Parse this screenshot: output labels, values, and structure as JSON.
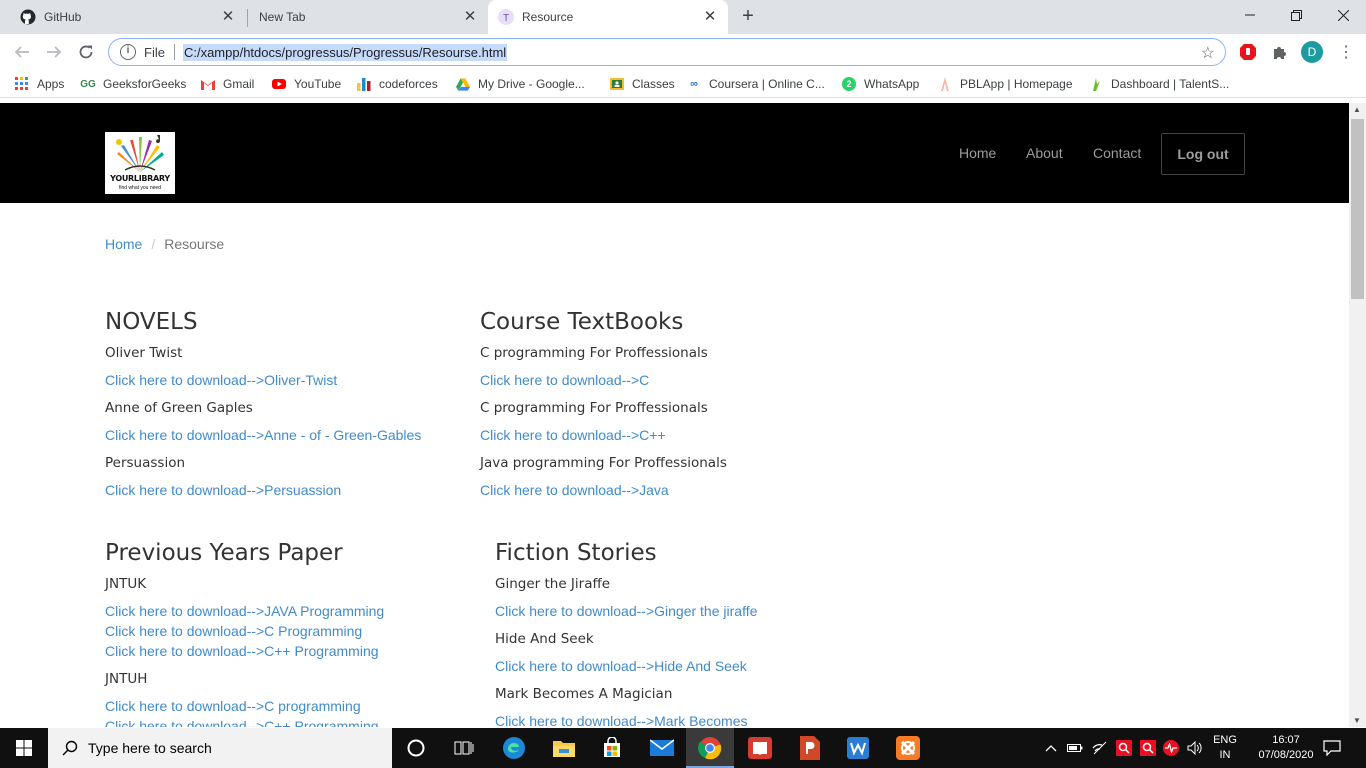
{
  "browser": {
    "tabs": [
      {
        "title": "GitHub",
        "icon": "github-icon"
      },
      {
        "title": "New Tab",
        "icon": ""
      },
      {
        "title": "Resource",
        "icon": "t-favicon-icon",
        "active": true
      }
    ],
    "address": {
      "security_label": "File",
      "url": "C:/xampp/htdocs/progressus/Progressus/Resourse.html"
    },
    "profile_initial": "D",
    "bookmarks": [
      {
        "label": "Apps",
        "icon": "apps-grid-icon"
      },
      {
        "label": "GeeksforGeeks",
        "icon": "gfg-icon"
      },
      {
        "label": "Gmail",
        "icon": "gmail-icon"
      },
      {
        "label": "YouTube",
        "icon": "youtube-icon"
      },
      {
        "label": "codeforces",
        "icon": "codeforces-icon"
      },
      {
        "label": "My Drive - Google...",
        "icon": "drive-icon"
      },
      {
        "label": "Classes",
        "icon": "classroom-icon"
      },
      {
        "label": "Coursera | Online C...",
        "icon": "coursera-icon"
      },
      {
        "label": "WhatsApp",
        "icon": "whatsapp-icon",
        "badge": "2"
      },
      {
        "label": "PBLApp | Homepage",
        "icon": "pblapp-icon"
      },
      {
        "label": "Dashboard | TalentS...",
        "icon": "talent-icon"
      }
    ]
  },
  "site": {
    "logo": {
      "word": "YOURLIBRARY",
      "tagline": "find what you need"
    },
    "nav": {
      "home": "Home",
      "about": "About",
      "contact": "Contact",
      "logout": "Log out"
    },
    "breadcrumb": {
      "home": "Home",
      "current": "Resourse"
    },
    "sections": {
      "novels": {
        "heading": "NOVELS",
        "items": [
          {
            "title": "Oliver Twist",
            "link": "Click here to download-->Oliver-Twist"
          },
          {
            "title": "Anne of Green Gaples",
            "link": "Click here to download-->Anne - of - Green-Gables"
          },
          {
            "title": "Persuassion",
            "link": "Click here to download-->Persuassion"
          }
        ]
      },
      "textbooks": {
        "heading": "Course TextBooks",
        "items": [
          {
            "title": "C programming For Proffessionals",
            "link": "Click here to download-->C"
          },
          {
            "title": "C programming For Proffessionals",
            "link": "Click here to download-->C++"
          },
          {
            "title": "Java programming For Proffessionals",
            "link": "Click here to download-->Java"
          }
        ]
      },
      "papers": {
        "heading": "Previous Years Paper",
        "groups": [
          {
            "title": "JNTUK",
            "links": [
              "Click here to download-->JAVA Programming",
              "Click here to download-->C Programming",
              "Click here to download-->C++ Programming"
            ]
          },
          {
            "title": "JNTUH",
            "links": [
              "Click here to download-->C programming",
              "Click here to download-->C++ Programming"
            ]
          }
        ]
      },
      "fiction": {
        "heading": "Fiction Stories",
        "items": [
          {
            "title": "Ginger the Jiraffe",
            "link": "Click here to download-->Ginger the jiraffe"
          },
          {
            "title": "Hide And Seek",
            "link": "Click here to download-->Hide And Seek"
          },
          {
            "title": "Mark Becomes A Magician",
            "link": "Click here to download-->Mark Becomes"
          }
        ]
      }
    }
  },
  "taskbar": {
    "search_placeholder": "Type here to search",
    "apps": [
      "cortana-icon",
      "task-view-icon",
      "edge-icon",
      "file-explorer-icon",
      "store-icon",
      "mail-icon",
      "chrome-icon",
      "reader-icon",
      "powerpoint-icon",
      "wps-icon",
      "xampp-icon"
    ],
    "lang_top": "ENG",
    "lang_bottom": "IN",
    "time": "16:07",
    "date": "07/08/2020"
  }
}
